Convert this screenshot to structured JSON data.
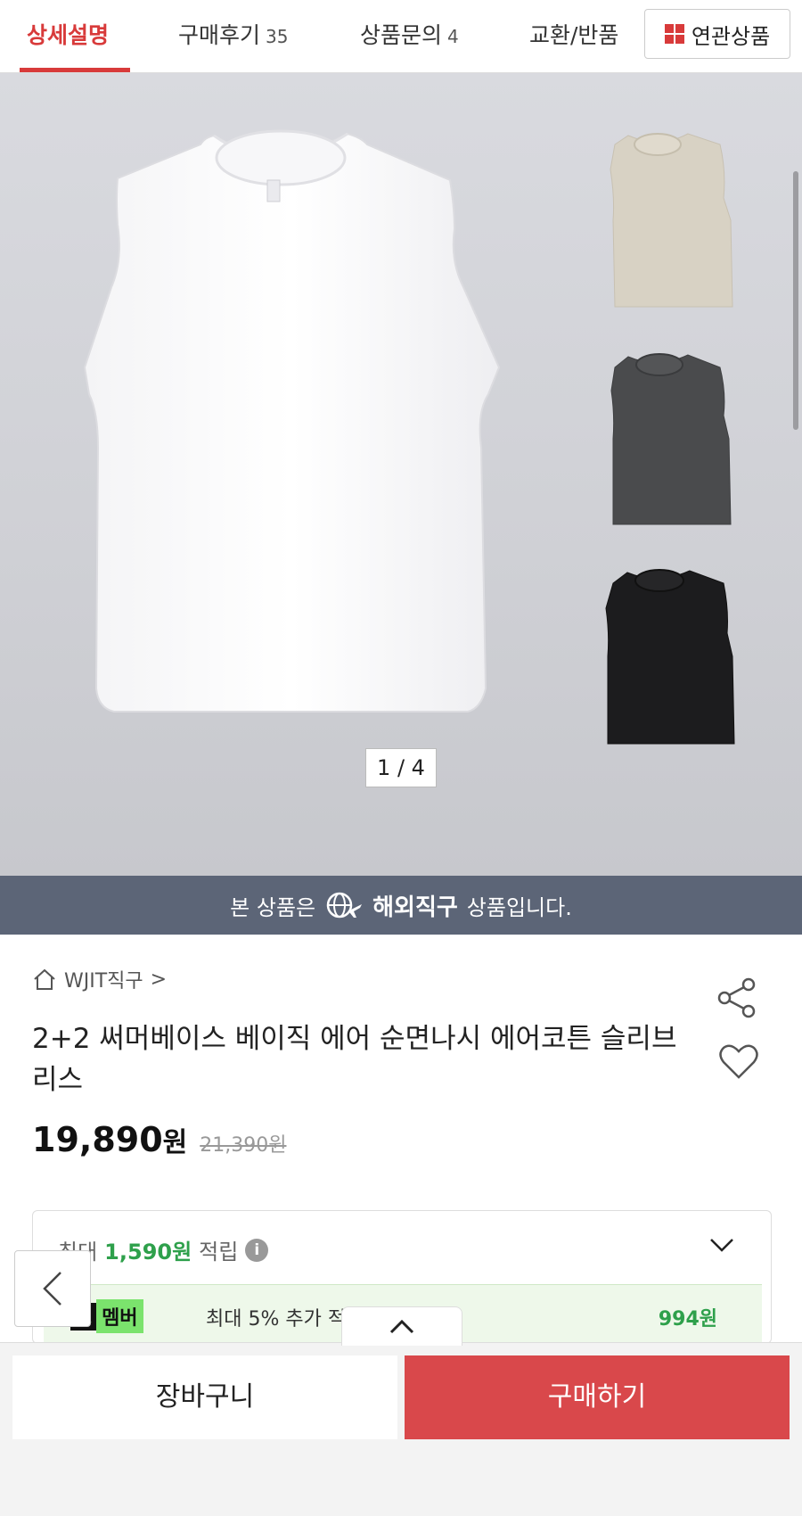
{
  "tabs": [
    {
      "label": "상세설명",
      "count": ""
    },
    {
      "label": "구매후기",
      "count": "35"
    },
    {
      "label": "상품문의",
      "count": "4"
    },
    {
      "label": "교환/반품",
      "count": ""
    }
  ],
  "related_button": "연관상품",
  "colors": {
    "accent": "#d83a3a",
    "points_green": "#2ea04b",
    "banner_bg": "#5c6577",
    "buy_red": "#d9484b"
  },
  "gallery": {
    "counter": "1 / 4",
    "shirt_colors": [
      "white",
      "beige",
      "charcoal",
      "black"
    ]
  },
  "banner": {
    "prefix": "본 상품은",
    "highlight": "해외직구",
    "suffix": "상품입니다."
  },
  "store": {
    "name": "WJIT직구",
    "chevron": ">"
  },
  "product": {
    "title": "2+2 써머베이스 베이직 에어 순면나시 에어코튼 슬리브리스",
    "price": "19,890",
    "price_unit": "원",
    "original_price": "21,390원"
  },
  "points": {
    "prefix": "최대",
    "amount": "1,590원",
    "suffix": "적립",
    "info_glyph": "i",
    "member_k": "K",
    "member_label": "멤버",
    "member_text": "최대 5% 추가 적립",
    "member_amount": "994원"
  },
  "bottom": {
    "cart": "장바구니",
    "buy": "구매하기"
  }
}
